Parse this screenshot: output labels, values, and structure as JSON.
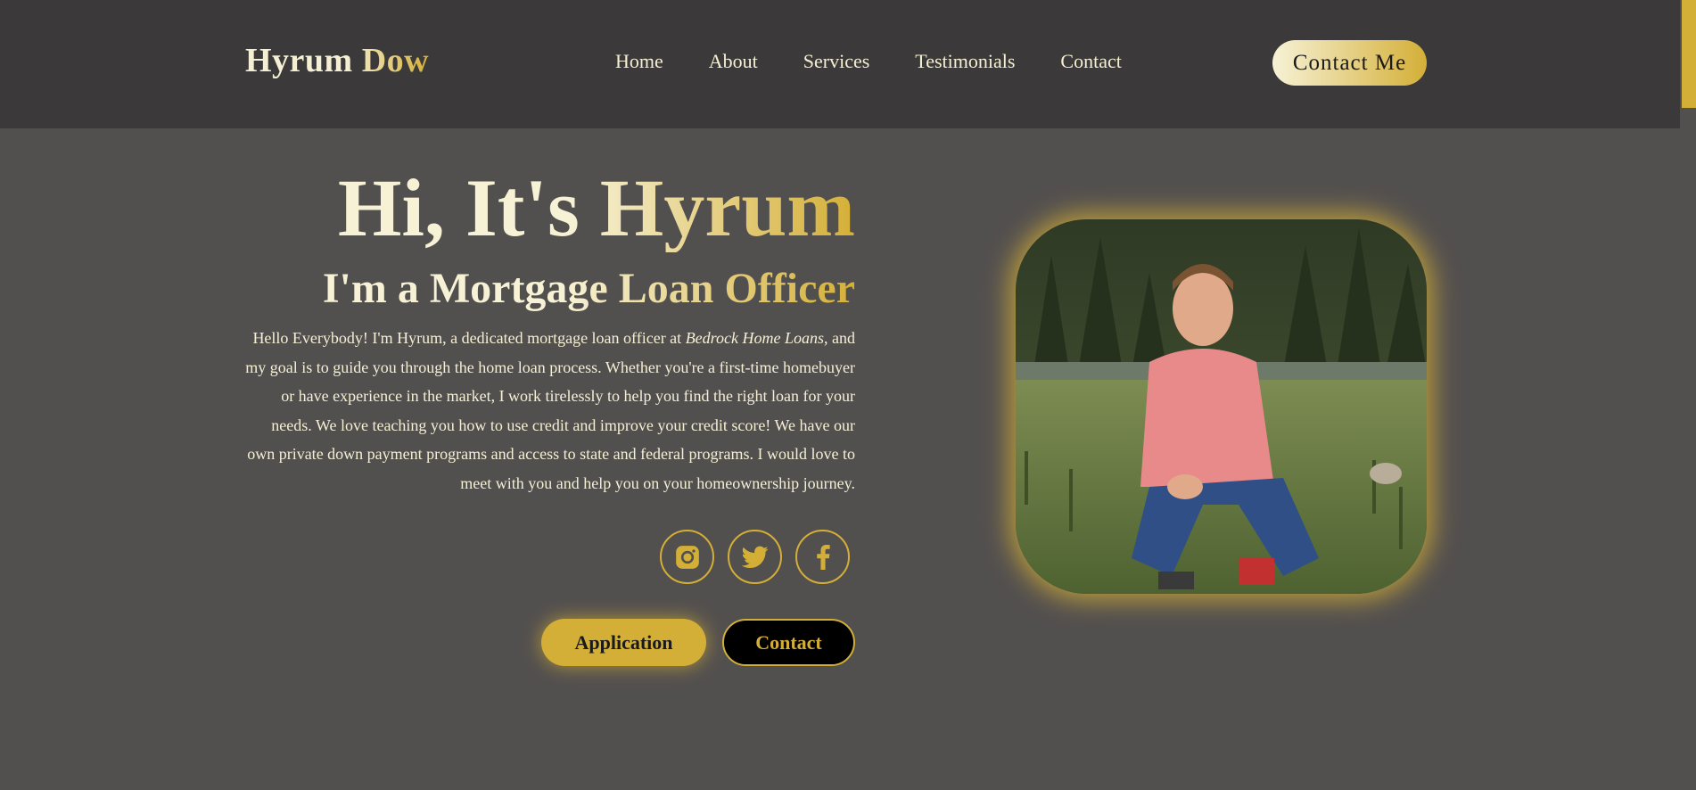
{
  "brand": {
    "name": "Hyrum Dow"
  },
  "nav": {
    "items": [
      {
        "label": "Home"
      },
      {
        "label": "About"
      },
      {
        "label": "Services"
      },
      {
        "label": "Testimonials"
      },
      {
        "label": "Contact"
      }
    ],
    "cta_label": "Contact Me"
  },
  "hero": {
    "title": "Hi, It's Hyrum",
    "subtitle": "I'm a Mortgage Loan Officer",
    "body_before": "Hello Everybody! I'm Hyrum, a dedicated mortgage loan officer at ",
    "body_company": "Bedrock Home Loans",
    "body_after": ", and my goal is to guide you through the home loan process. Whether you're a first-time homebuyer or have experience in the market, I work tirelessly to help you find the right loan for your needs. We love teaching you how to use credit and improve your credit score! We have our own private down payment programs and access to state and federal programs. I would love to meet with you and help you on your homeownership journey.",
    "socials": [
      {
        "icon": "instagram-icon"
      },
      {
        "icon": "twitter-icon"
      },
      {
        "icon": "facebook-icon"
      }
    ],
    "application_label": "Application",
    "contact_label": "Contact"
  },
  "colors": {
    "accent": "#d4af37",
    "cream": "#f5efd4",
    "header_bg": "#3b3939",
    "page_bg": "#524f4f"
  }
}
